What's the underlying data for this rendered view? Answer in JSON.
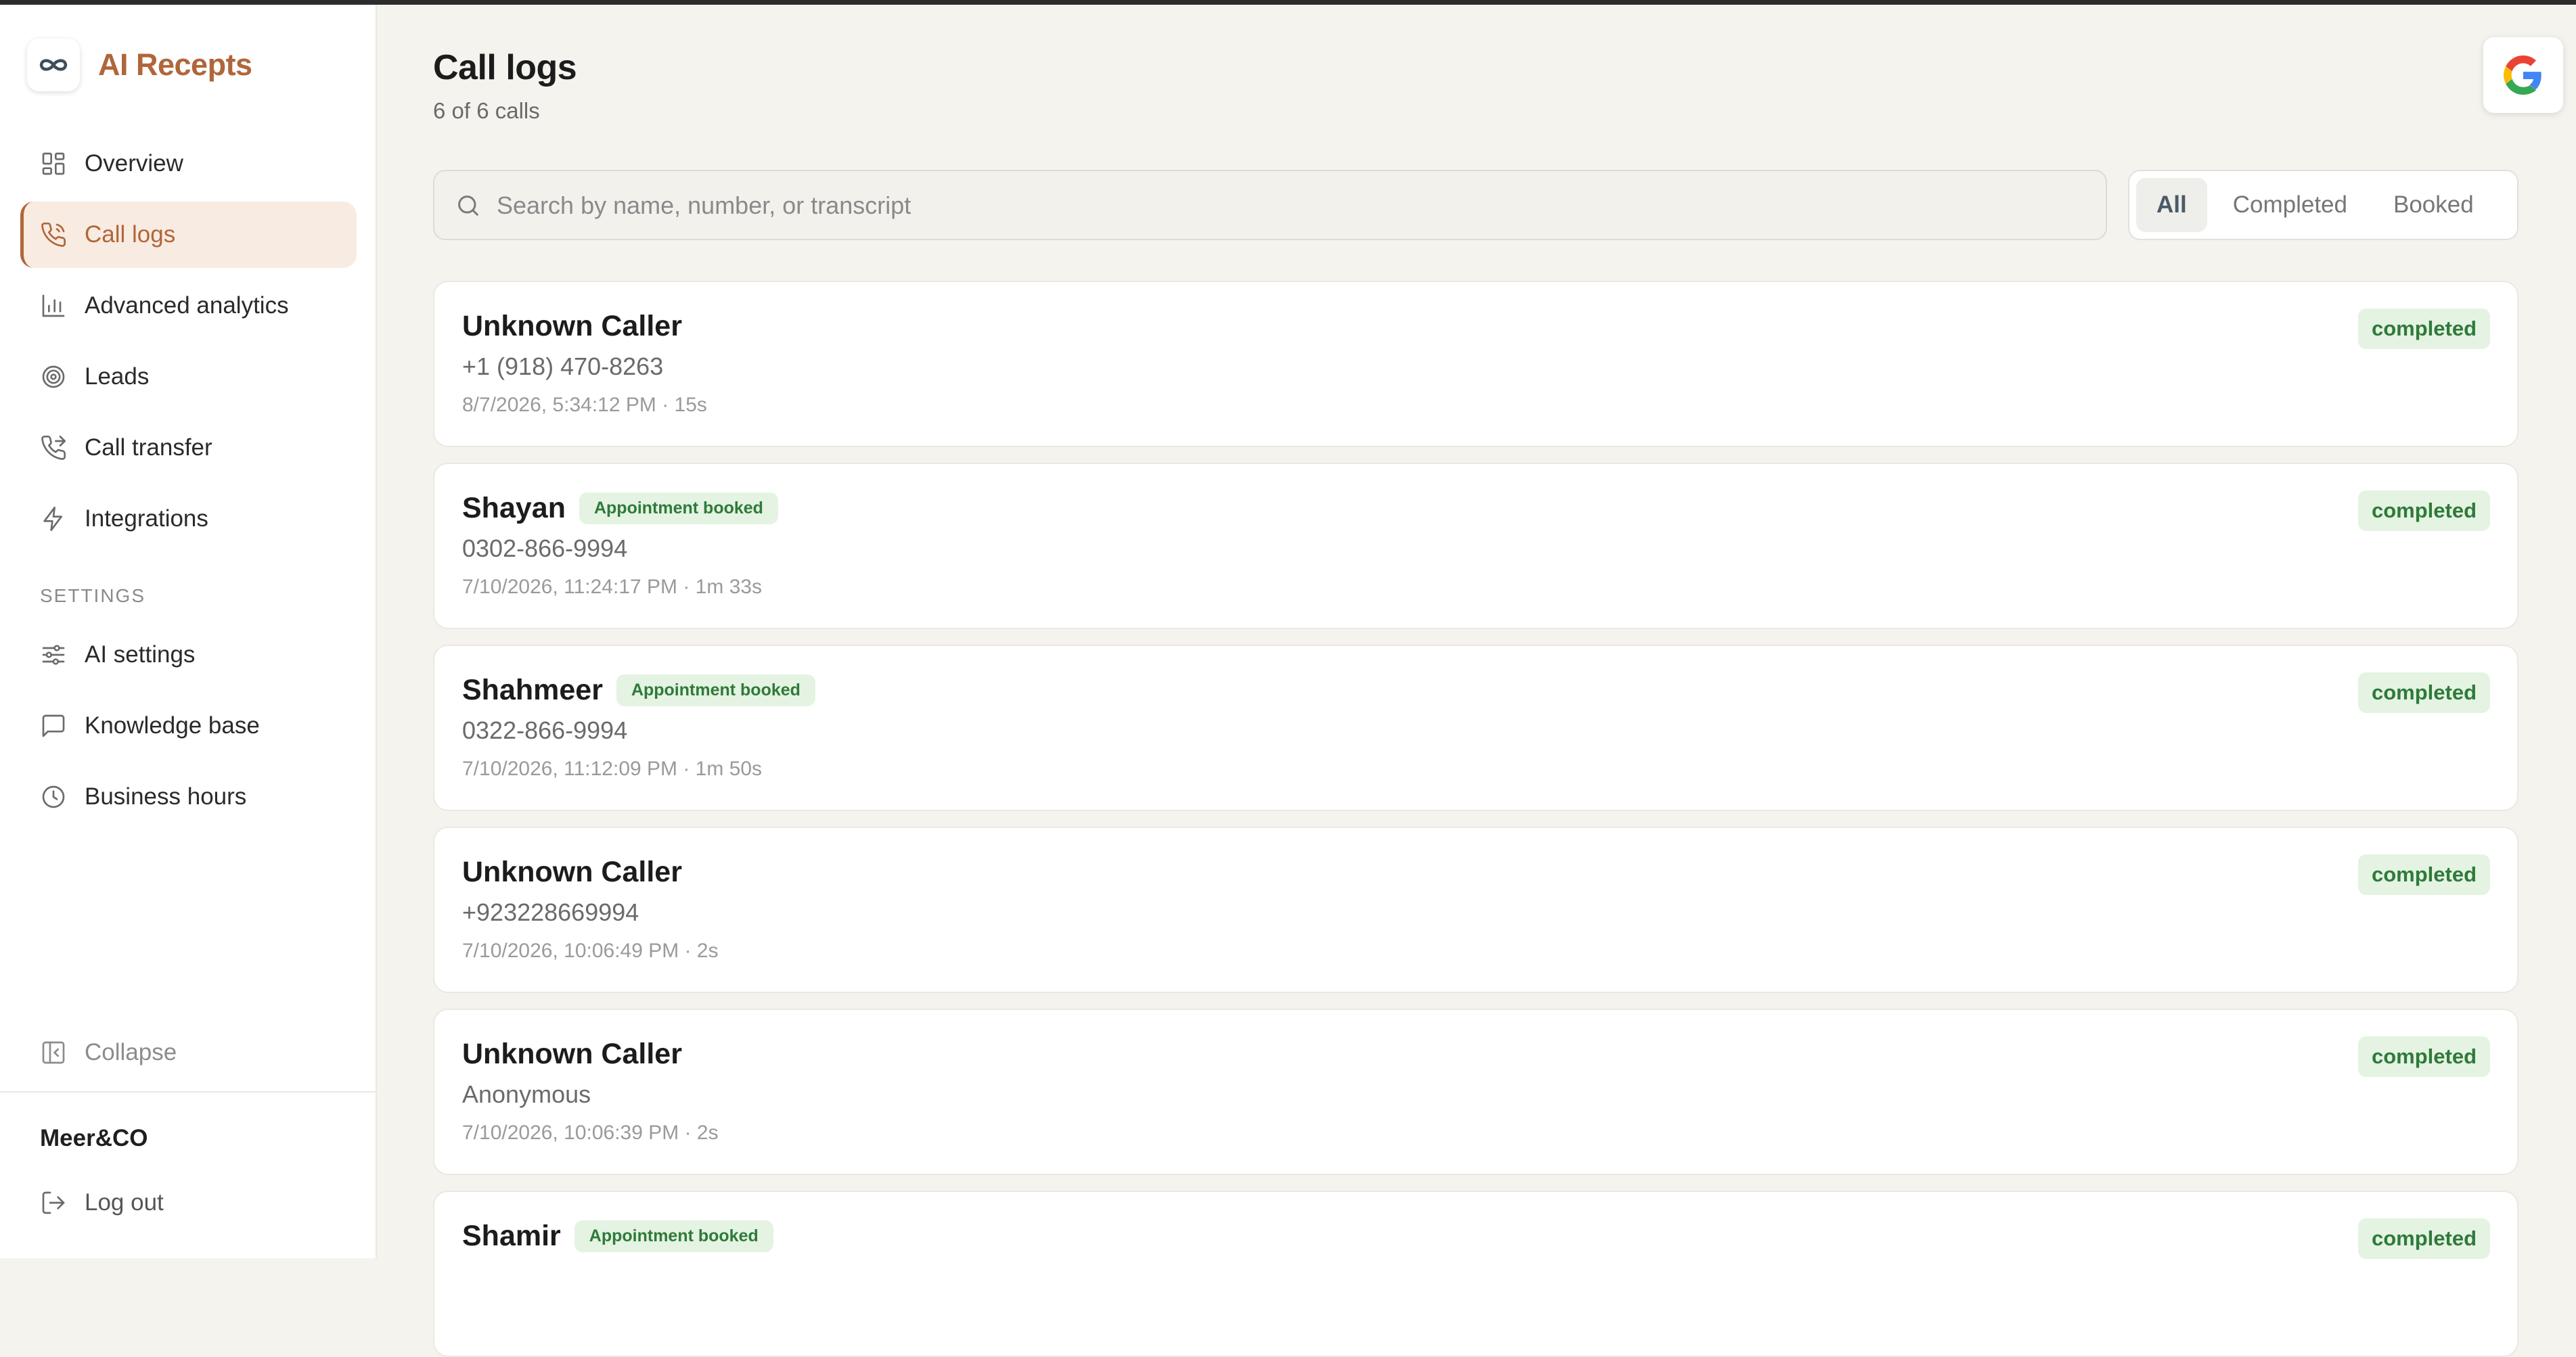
{
  "app": {
    "name": "AI Recepts"
  },
  "sidebar": {
    "nav": [
      {
        "label": "Overview",
        "icon": "overview-icon"
      },
      {
        "label": "Call logs",
        "icon": "phone-icon",
        "active": true
      },
      {
        "label": "Advanced analytics",
        "icon": "bar-chart-icon"
      },
      {
        "label": "Leads",
        "icon": "target-icon"
      },
      {
        "label": "Call transfer",
        "icon": "phone-forward-icon"
      },
      {
        "label": "Integrations",
        "icon": "lightning-icon"
      }
    ],
    "settings_label": "SETTINGS",
    "settings": [
      {
        "label": "AI settings",
        "icon": "sliders-icon"
      },
      {
        "label": "Knowledge base",
        "icon": "message-icon"
      },
      {
        "label": "Business hours",
        "icon": "clock-icon"
      }
    ],
    "collapse_label": "Collapse",
    "org_name": "Meer&CO",
    "logout_label": "Log out"
  },
  "header": {
    "title": "Call logs",
    "subtitle": "6 of 6 calls"
  },
  "search": {
    "placeholder": "Search by name, number, or transcript",
    "value": ""
  },
  "filters": {
    "tabs": [
      "All",
      "Completed",
      "Booked"
    ],
    "selected": "All"
  },
  "calls": [
    {
      "name": "Unknown Caller",
      "booked": false,
      "booked_label": "",
      "number": "+1 (918) 470-8263",
      "meta": "8/7/2026, 5:34:12 PM · 15s",
      "status": "completed"
    },
    {
      "name": "Shayan",
      "booked": true,
      "booked_label": "Appointment booked",
      "number": "0302-866-9994",
      "meta": "7/10/2026, 11:24:17 PM · 1m 33s",
      "status": "completed"
    },
    {
      "name": "Shahmeer",
      "booked": true,
      "booked_label": "Appointment booked",
      "number": "0322-866-9994",
      "meta": "7/10/2026, 11:12:09 PM · 1m 50s",
      "status": "completed"
    },
    {
      "name": "Unknown Caller",
      "booked": false,
      "booked_label": "",
      "number": "+923228669994",
      "meta": "7/10/2026, 10:06:49 PM · 2s",
      "status": "completed"
    },
    {
      "name": "Unknown Caller",
      "booked": false,
      "booked_label": "",
      "number": "Anonymous",
      "meta": "7/10/2026, 10:06:39 PM · 2s",
      "status": "completed"
    },
    {
      "name": "Shamir",
      "booked": true,
      "booked_label": "Appointment booked",
      "number": "",
      "meta": "",
      "status": "completed"
    }
  ],
  "colors": {
    "accent": "#b0663a",
    "active_bg": "#f8ebe1",
    "badge_bg": "#e4f3e2",
    "badge_text": "#2f7a3a",
    "page_bg": "#f5f3ee"
  }
}
